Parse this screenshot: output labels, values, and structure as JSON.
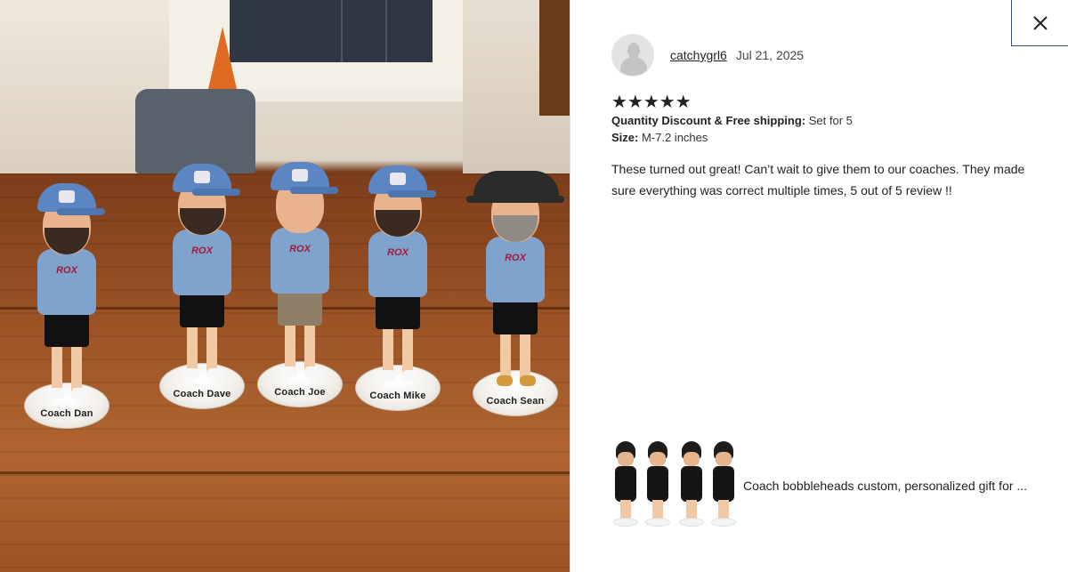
{
  "photo": {
    "figurines": [
      {
        "name_label": "Coach Dan",
        "shirt_text": "ROX"
      },
      {
        "name_label": "Coach Dave",
        "shirt_text": "ROX"
      },
      {
        "name_label": "Coach Joe",
        "shirt_text": "ROX"
      },
      {
        "name_label": "Coach Mike",
        "shirt_text": "ROX"
      },
      {
        "name_label": "Coach Sean",
        "shirt_text": "ROX"
      }
    ]
  },
  "close": {
    "icon": "close-icon"
  },
  "review": {
    "reviewer_name": "catchygrl6",
    "date": "Jul 21, 2025",
    "rating": 5,
    "stars": "★★★★★",
    "variations": [
      {
        "label": "Quantity Discount & Free shipping:",
        "value": "Set for 5"
      },
      {
        "label": "Size:",
        "value": "M-7.2 inches"
      }
    ],
    "text": "These turned out great! Can’t wait to give them to our coaches. They made sure everything was correct multiple times, 5 out of 5 review !!"
  },
  "product": {
    "title": "Coach bobbleheads custom, personalized gift for ..."
  },
  "colors": {
    "panel_border": "#3b4a7a",
    "text": "#222222",
    "shirt_blue": "#7fa3cc",
    "cap_blue": "#5b86c2"
  }
}
